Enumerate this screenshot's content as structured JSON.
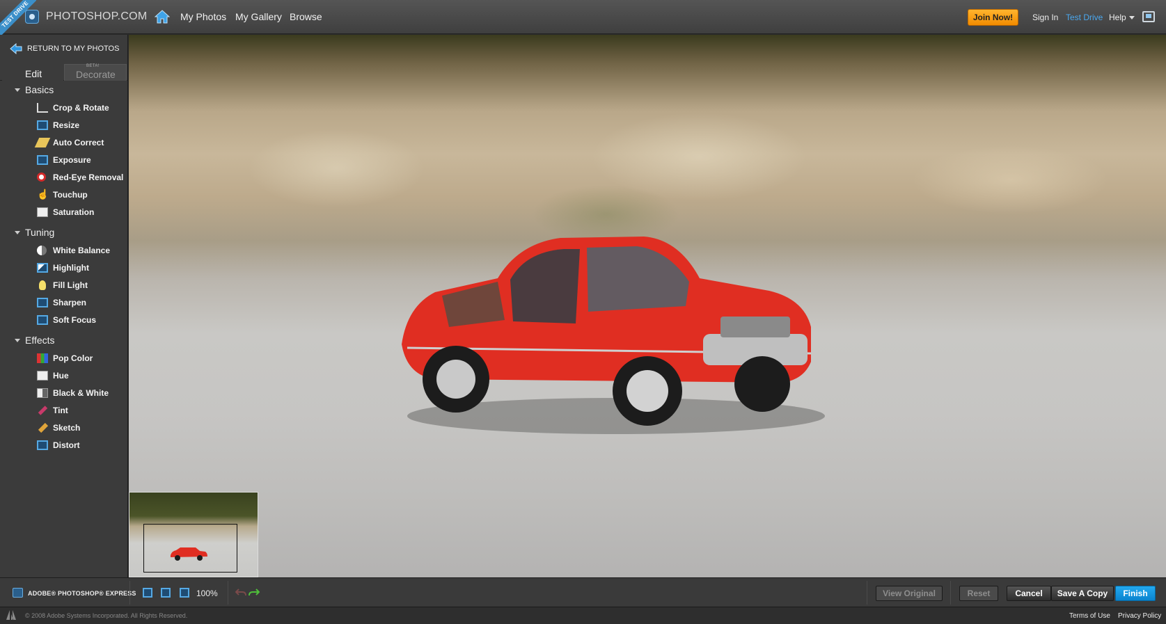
{
  "ribbon": {
    "label": "TEST DRIVE"
  },
  "brand": {
    "name": "PHOTOSHOP.COM"
  },
  "nav": {
    "items": [
      "My Photos",
      "My Gallery",
      "Browse"
    ]
  },
  "account": {
    "join_label": "Join Now!",
    "sign_in": "Sign In",
    "test_drive": "Test Drive",
    "help": "Help"
  },
  "sidebar": {
    "return_label": "RETURN TO MY PHOTOS",
    "tabs": {
      "edit": "Edit",
      "decorate": "Decorate",
      "beta": "BETA!"
    },
    "sections": {
      "basics": {
        "title": "Basics",
        "tools": [
          "Crop & Rotate",
          "Resize",
          "Auto Correct",
          "Exposure",
          "Red-Eye Removal",
          "Touchup",
          "Saturation"
        ]
      },
      "tuning": {
        "title": "Tuning",
        "tools": [
          "White Balance",
          "Highlight",
          "Fill Light",
          "Sharpen",
          "Soft Focus"
        ]
      },
      "effects": {
        "title": "Effects",
        "tools": [
          "Pop Color",
          "Hue",
          "Black & White",
          "Tint",
          "Sketch",
          "Distort"
        ]
      }
    }
  },
  "toolbar": {
    "app_label": "ADOBE® PHOTOSHOP® EXPRESS",
    "zoom": "100%",
    "view_original": "View Original",
    "reset": "Reset",
    "cancel": "Cancel",
    "save_copy": "Save A Copy",
    "finish": "Finish"
  },
  "footer": {
    "copyright": "© 2008 Adobe Systems Incorporated. All Rights Reserved.",
    "terms": "Terms of Use",
    "privacy": "Privacy Policy"
  },
  "colors": {
    "accent": "#1a9be6",
    "join": "#f7a11a",
    "car": "#e02e22"
  }
}
